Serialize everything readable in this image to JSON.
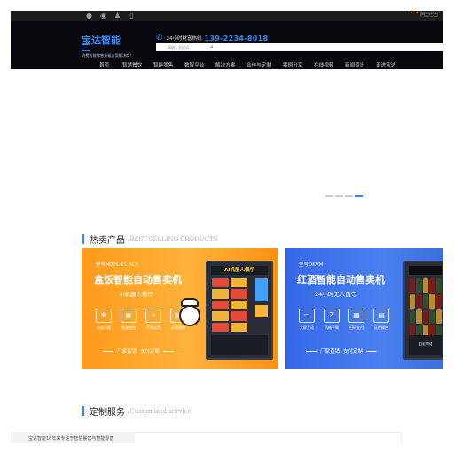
{
  "topbar": {
    "icons": [
      "wechat-icon",
      "weibo-icon",
      "qq-icon",
      "mobile-icon"
    ],
    "alibaba_logo": "⌒",
    "alibaba_text": "阿里巴巴"
  },
  "header": {
    "brand": "宝达智能",
    "slogan": "消费智能零售升级方案解决商!",
    "hotline_label": "24小时财富热线",
    "hotline_number": "139-2234-8018",
    "search_placeholder": "请输入关键词",
    "accent": "#2f88ff"
  },
  "nav": {
    "items": [
      "首页",
      "智慧餐饮",
      "智能零售",
      "数智平台",
      "解决方案",
      "合作与定制",
      "案例分享",
      "在线视频",
      "新闻资讯",
      "走进宝达"
    ]
  },
  "banner": {
    "dots": 4,
    "active_dot": 3
  },
  "sections": {
    "hot": {
      "cn": "热卖产品",
      "en": "/BEST-SELLING PRODUCTS"
    },
    "custom": {
      "cn": "定制服务",
      "en": "/Customized service"
    }
  },
  "products": [
    {
      "model": "型号M001-21.5CH",
      "title": "盒饭智能自动售卖机",
      "subtitle": "AI机器人餐厅",
      "machine_label": "AI机器人餐厅",
      "features": [
        "快速冷藏",
        "微波加热",
        "不锈洁净",
        "远程操控"
      ],
      "tags": [
        "厂家直销",
        "支付定制"
      ],
      "color": "#ffa024"
    },
    {
      "model": "型号DKVM",
      "title": "红酒智能自动售卖机",
      "subtitle": "24小时无人值守",
      "machine_label": "DKVM",
      "features": [
        "大屏互动",
        "机械手臂",
        "扫码支付",
        "远程操控"
      ],
      "tags": [
        "厂家直销",
        "支付定制"
      ],
      "color": "#3e74ea"
    }
  ],
  "footer": {
    "text": "宝达智能18年来专注于智慧餐饮与智能零售"
  }
}
